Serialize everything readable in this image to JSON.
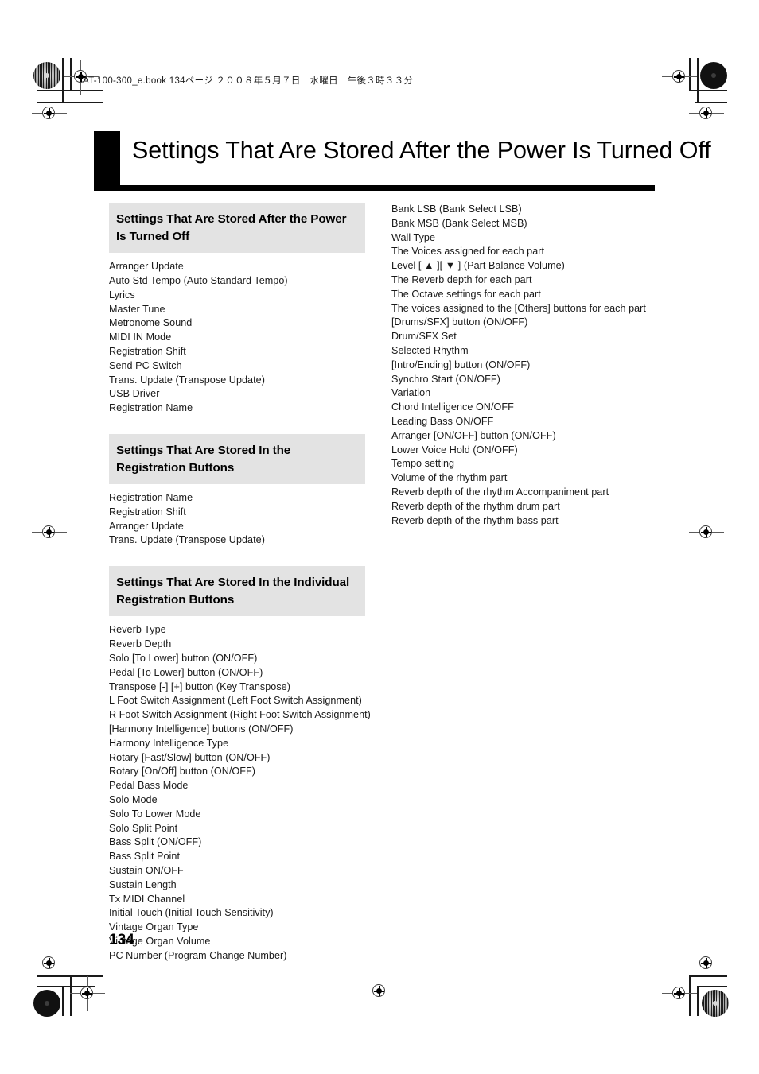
{
  "header": {
    "running_header": "AT-100-300_e.book  134ページ  ２００８年５月７日　水曜日　午後３時３３分"
  },
  "title": {
    "text": "Settings That Are Stored After the Power Is Turned Off"
  },
  "page": {
    "number": "134"
  },
  "left_column": {
    "sections": [
      {
        "heading": "Settings That Are Stored After the Power Is Turned Off",
        "items": [
          "Arranger Update",
          "Auto Std Tempo (Auto Standard Tempo)",
          "Lyrics",
          "Master Tune",
          "Metronome Sound",
          "MIDI IN Mode",
          "Registration Shift",
          "Send PC Switch",
          "Trans. Update (Transpose Update)",
          "USB Driver",
          "Registration Name"
        ]
      },
      {
        "heading": "Settings That Are Stored In the Registration Buttons",
        "items": [
          "Registration Name",
          "Registration Shift",
          "Arranger Update",
          "Trans. Update (Transpose Update)"
        ]
      },
      {
        "heading": "Settings That Are Stored In the Individual Registration Buttons",
        "items": [
          "Reverb Type",
          "Reverb Depth",
          "Solo [To Lower] button (ON/OFF)",
          "Pedal [To Lower] button (ON/OFF)",
          "Transpose [-] [+] button (Key Transpose)",
          "L Foot Switch Assignment (Left Foot Switch Assignment)",
          "R Foot Switch Assignment (Right Foot Switch Assignment)",
          "[Harmony Intelligence] buttons (ON/OFF)",
          "Harmony Intelligence Type",
          "Rotary [Fast/Slow] button (ON/OFF)",
          "Rotary [On/Off] button (ON/OFF)",
          "Pedal Bass Mode",
          "Solo Mode",
          "Solo To Lower Mode",
          "Solo Split Point",
          "Bass Split (ON/OFF)",
          "Bass Split Point",
          "Sustain ON/OFF",
          "Sustain Length",
          "Tx MIDI Channel",
          "Initial Touch (Initial Touch Sensitivity)",
          "Vintage Organ Type",
          "Vintage Organ Volume",
          "PC Number (Program Change Number)"
        ]
      }
    ]
  },
  "right_column": {
    "items": [
      "Bank LSB (Bank Select LSB)",
      "Bank MSB (Bank Select MSB)",
      "Wall Type",
      "The Voices assigned for each part",
      "Level [ ▲ ][ ▼ ] (Part Balance Volume)",
      "The Reverb depth for each part",
      "The Octave settings for each part",
      "The voices assigned to the [Others] buttons for each part",
      "[Drums/SFX] button (ON/OFF)",
      "Drum/SFX Set",
      "Selected Rhythm",
      "[Intro/Ending] button (ON/OFF)",
      "Synchro Start (ON/OFF)",
      "Variation",
      "Chord Intelligence ON/OFF",
      "Leading Bass ON/OFF",
      "Arranger [ON/OFF] button (ON/OFF)",
      "Lower Voice Hold (ON/OFF)",
      "Tempo setting",
      "Volume of the rhythm part",
      "Reverb depth of the rhythm Accompaniment part",
      "Reverb depth of the rhythm drum part",
      "Reverb depth of the rhythm bass part"
    ]
  },
  "colors": {
    "section_header_bg": "#e3e3e3",
    "title_block": "#000000",
    "text": "#1a1a1a"
  }
}
